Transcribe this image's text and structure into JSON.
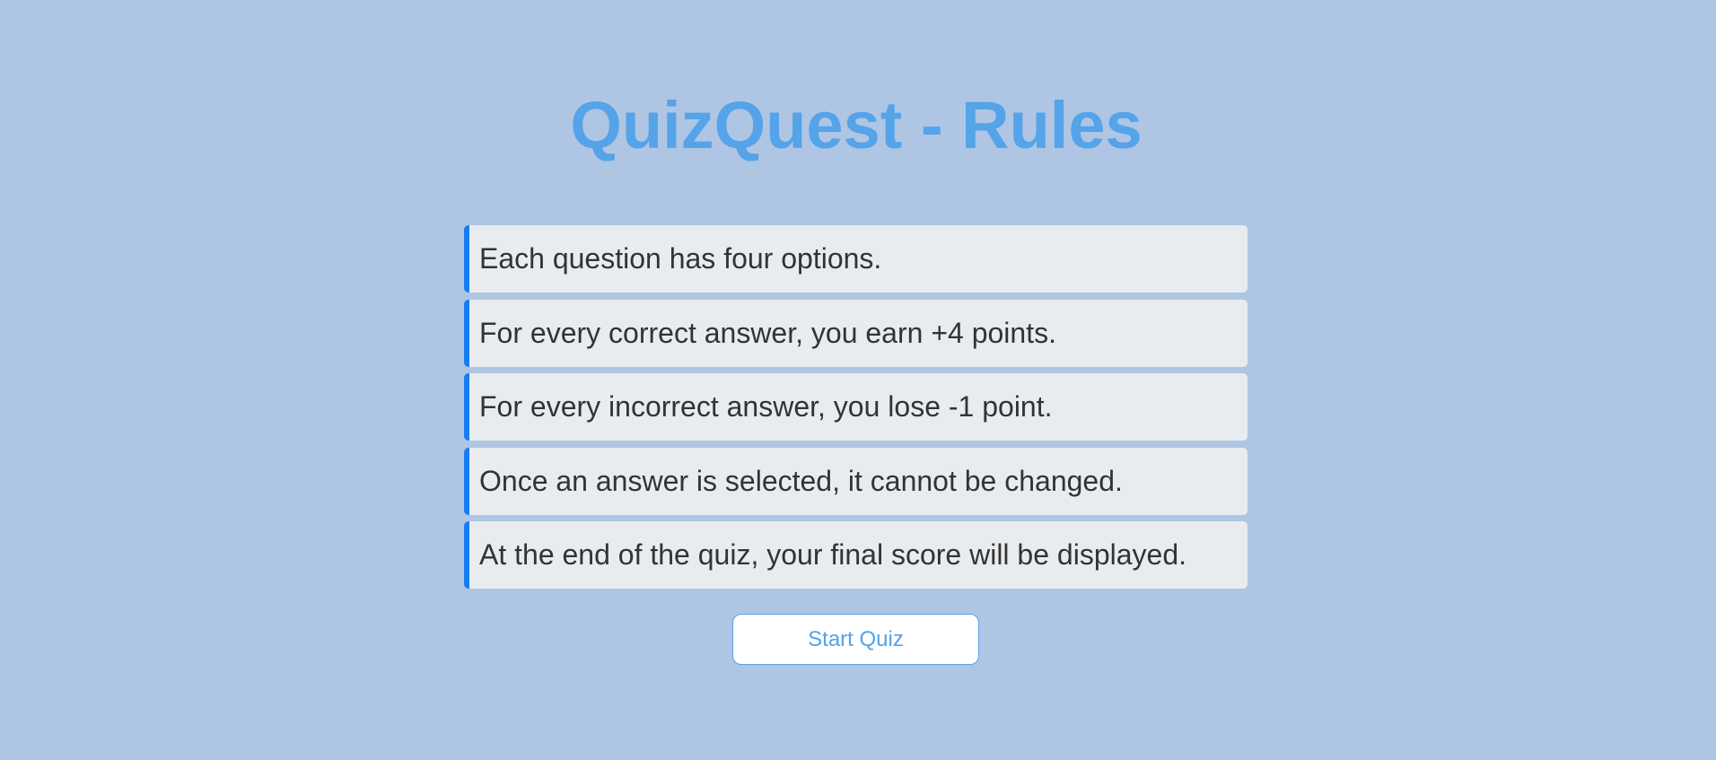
{
  "page": {
    "title": "QuizQuest - Rules"
  },
  "rules": [
    "Each question has four options.",
    "For every correct answer, you earn +4 points.",
    "For every incorrect answer, you lose -1 point.",
    "Once an answer is selected, it cannot be changed.",
    "At the end of the quiz, your final score will be displayed."
  ],
  "actions": {
    "start_label": "Start Quiz"
  },
  "colors": {
    "background": "#aec6e4",
    "title": "#55a3e8",
    "rule_background": "#e9ecef",
    "rule_accent": "#1a7cf0",
    "rule_text": "#333333",
    "button_background": "#ffffff",
    "button_text": "#55a3e8"
  }
}
